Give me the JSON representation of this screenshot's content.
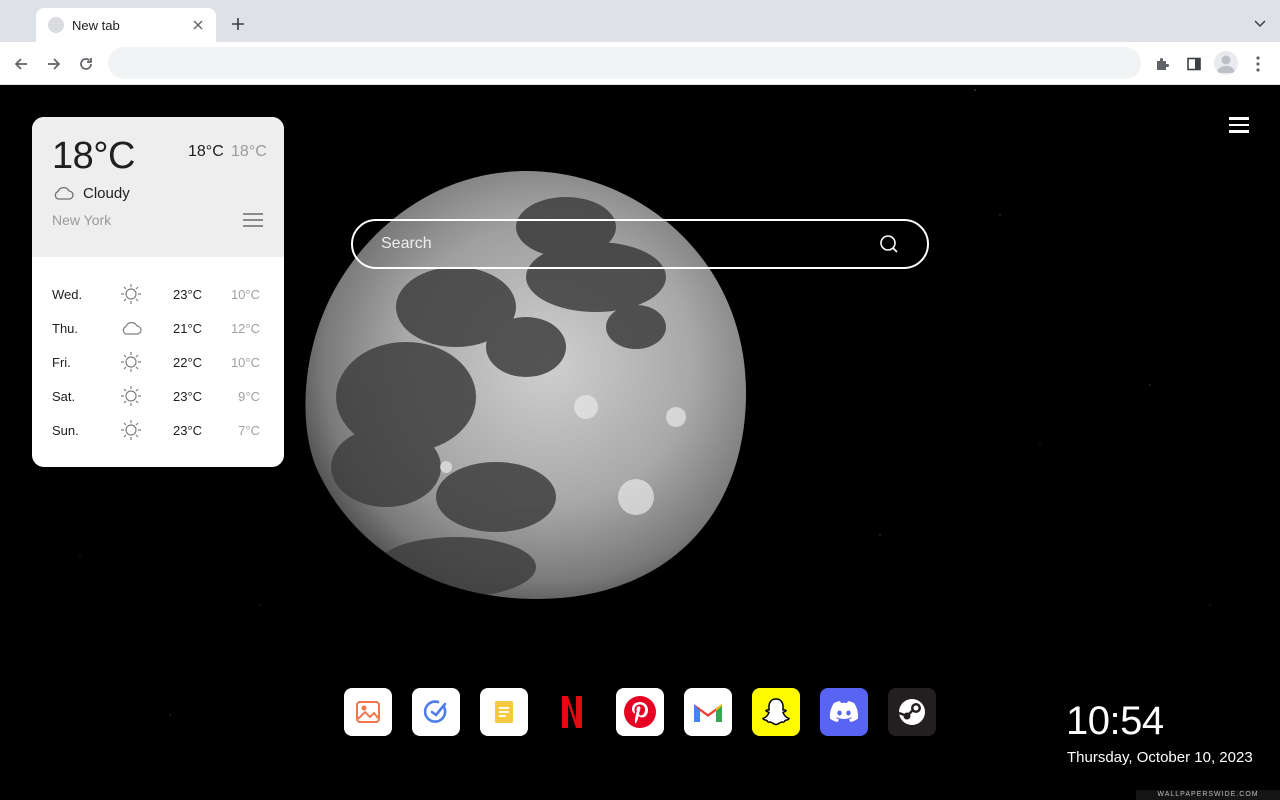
{
  "browser": {
    "tab_title": "New tab",
    "omnibox_value": "",
    "omnibox_placeholder": ""
  },
  "weather": {
    "current_temp": "18°C",
    "high": "18°C",
    "low": "18°C",
    "condition": "Cloudy",
    "condition_icon": "cloud-icon",
    "city": "New York",
    "forecast": [
      {
        "day": "Wed.",
        "icon": "sun-icon",
        "high": "23°C",
        "low": "10°C"
      },
      {
        "day": "Thu.",
        "icon": "cloud-icon",
        "high": "21°C",
        "low": "12°C"
      },
      {
        "day": "Fri.",
        "icon": "sun-icon",
        "high": "22°C",
        "low": "10°C"
      },
      {
        "day": "Sat.",
        "icon": "sun-icon",
        "high": "23°C",
        "low": "9°C"
      },
      {
        "day": "Sun.",
        "icon": "sun-icon",
        "high": "23°C",
        "low": "7°C"
      }
    ]
  },
  "search": {
    "placeholder": "Search"
  },
  "dock": {
    "apps": [
      {
        "name": "photos-icon",
        "bg": "#ffffff"
      },
      {
        "name": "task-icon",
        "bg": "#ffffff"
      },
      {
        "name": "notes-icon",
        "bg": "#ffffff"
      },
      {
        "name": "netflix-icon",
        "bg": "#000000"
      },
      {
        "name": "pinterest-icon",
        "bg": "#ffffff"
      },
      {
        "name": "gmail-icon",
        "bg": "#ffffff"
      },
      {
        "name": "snapchat-icon",
        "bg": "#fffc00"
      },
      {
        "name": "discord-icon",
        "bg": "#5865f2"
      },
      {
        "name": "steam-icon",
        "bg": "#231f20"
      }
    ]
  },
  "clock": {
    "time": "10:54",
    "date": "Thursday, October 10, 2023"
  },
  "watermark": "WALLPAPERSWIDE.COM"
}
